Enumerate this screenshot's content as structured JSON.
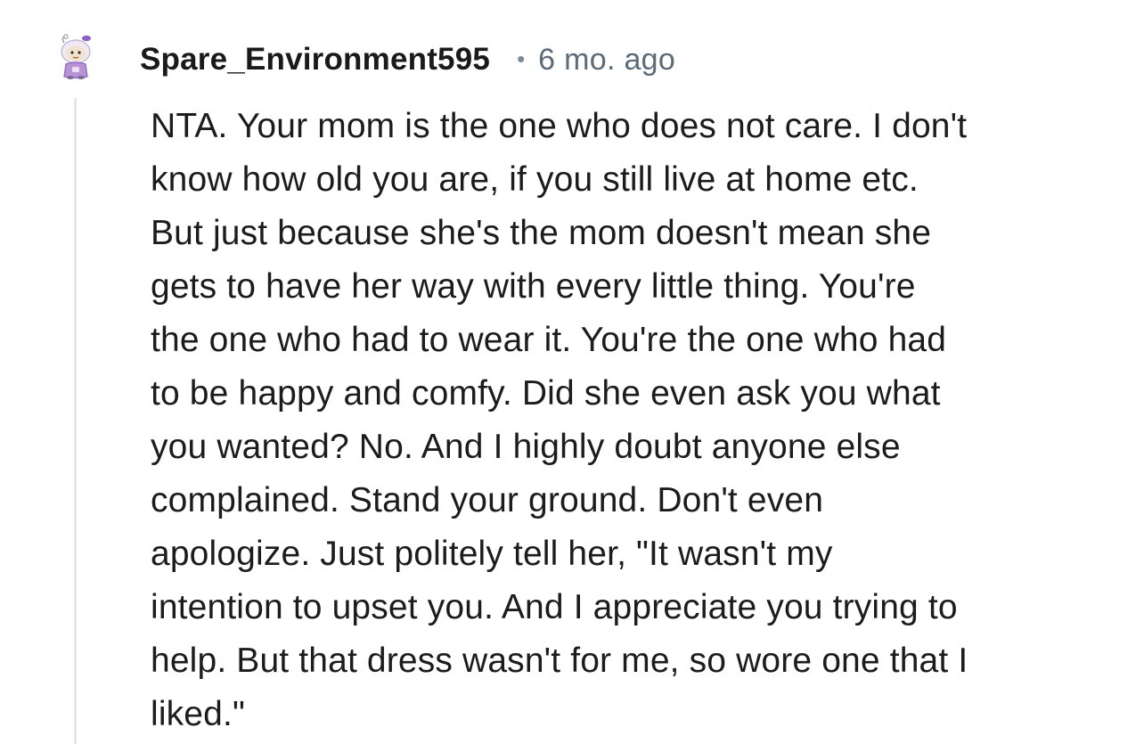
{
  "comment": {
    "author": "Spare_Environment595",
    "separator": "•",
    "timestamp": "6 mo. ago",
    "body_lines": [
      "NTA. Your mom is the one who does not care. I don't",
      "know how old you are, if you still live at home etc.",
      "But just because she's the mom doesn't mean she",
      "gets to have her way with every little thing. You're",
      "the one who had to wear it. You're the one who had",
      "to be happy and comfy. Did she even ask you what",
      "you wanted? No. And I highly doubt anyone else",
      "complained. Stand your ground. Don't even",
      "apologize. Just politely tell her, \"It wasn't my",
      "intention to upset you. And I appreciate you trying to",
      "help. But that dress wasn't for me, so wore one that I",
      "liked.\""
    ],
    "avatar": {
      "icon": "snoo-avatar-icon",
      "colors": {
        "skin": "#f2e3cf",
        "hair": "#e9e1f2",
        "body": "#b793d6",
        "accent": "#8b62c9"
      }
    }
  },
  "colors": {
    "background": "#ffffff",
    "username": "#1a1a1b",
    "meta": "#5b6b77",
    "body": "#1c1c1c",
    "thread_line": "#e4e6e8"
  }
}
